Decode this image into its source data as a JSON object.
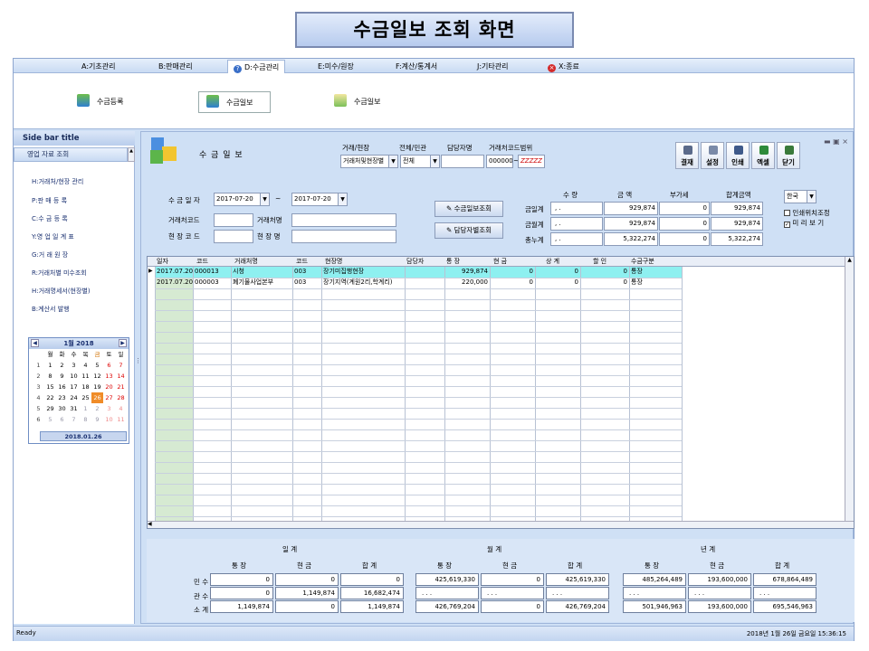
{
  "page_title": "수금일보 조회 화면",
  "menu": [
    {
      "label": "A:기초관리"
    },
    {
      "label": "B:판매관리"
    },
    {
      "label": "D:수금관리"
    },
    {
      "label": "E:미수/원장"
    },
    {
      "label": "F:계산/통계서"
    },
    {
      "label": "J:기타관리"
    },
    {
      "label": "X:종료"
    }
  ],
  "ribbon": {
    "b1": "수금등록",
    "b2": "수금일보",
    "b3": "수금일보"
  },
  "sidebar": {
    "title": "Side bar title",
    "section": "영업 자료 조회",
    "items": [
      "H:거래처/현장 관리",
      "P:판 매 등 록",
      "C:수 금 등 록",
      "Y:영 업 일 계 표",
      "G:거 래 원 장",
      "R:거래처별 미수조회",
      "H:거래명세서(현장별)",
      "B:계산서 발행"
    ]
  },
  "calendar": {
    "month": "1월 2018",
    "weekdays": [
      "월",
      "화",
      "수",
      "목",
      "금",
      "토",
      "일"
    ],
    "weeks": [
      {
        "n": "1",
        "d": [
          "1",
          "2",
          "3",
          "4",
          "5",
          "6",
          "7"
        ]
      },
      {
        "n": "2",
        "d": [
          "8",
          "9",
          "10",
          "11",
          "12",
          "13",
          "14"
        ]
      },
      {
        "n": "3",
        "d": [
          "15",
          "16",
          "17",
          "18",
          "19",
          "20",
          "21"
        ]
      },
      {
        "n": "4",
        "d": [
          "22",
          "23",
          "24",
          "25",
          "26",
          "27",
          "28"
        ]
      },
      {
        "n": "5",
        "d": [
          "29",
          "30",
          "31",
          "1",
          "2",
          "3",
          "4"
        ]
      },
      {
        "n": "6",
        "d": [
          "5",
          "6",
          "7",
          "8",
          "9",
          "10",
          "11"
        ]
      }
    ],
    "today": "2018.01.26"
  },
  "form": {
    "title": "수 금 일 보",
    "l_trade": "거래/현장",
    "trade_value": "거래처및현장별",
    "l_all": "전체/민관",
    "all_value": "전체",
    "l_manager": "담당자명",
    "l_range": "거래처코드범위",
    "range_from": "000000",
    "range_to": "ZZZZZ",
    "l_date": "수 금 일 자",
    "date_from": "2017-07-20",
    "tilde": "~",
    "date_to": "2017-07-20",
    "l_code": "거래처코드",
    "l_name": "거래처명",
    "l_sitecode": "현 장 코 드",
    "l_sitename": "현 장 명",
    "btn_query": "수금일보조회",
    "btn_manager": "담당자별조회"
  },
  "toolbar": {
    "b1": "결재",
    "b2": "설정",
    "b3": "인쇄",
    "b4": "엑셀",
    "b5": "닫기"
  },
  "summary": {
    "headers": [
      "수 량",
      "금 액",
      "부가세",
      "합계금액"
    ],
    "rows": [
      {
        "label": "금일계",
        "qty": ",  .",
        "amt": "929,874",
        "vat": "0",
        "total": "929,874"
      },
      {
        "label": "금월계",
        "qty": ",  .",
        "amt": "929,874",
        "vat": "0",
        "total": "929,874"
      },
      {
        "label": "총누계",
        "qty": ",  .",
        "amt": "5,322,274",
        "vat": "0",
        "total": "5,322,274"
      }
    ],
    "lang": "한국",
    "chk1": "인쇄위치조정",
    "chk2": "미 리 보 기"
  },
  "grid": {
    "columns": [
      "일자",
      "코드",
      "거래처명",
      "코드",
      "현장명",
      "담당자",
      "통 장",
      "현 금",
      "상 계",
      "할 인",
      "수금구분"
    ],
    "rows": [
      [
        "2017.07.20",
        "000013",
        "시청",
        "003",
        "장기미집행현장",
        "",
        "929,874",
        "0",
        "0",
        "0",
        "통장"
      ],
      [
        "2017.07.20",
        "000003",
        "폐기물사업본부",
        "003",
        "장기지역(계원2리,학계리)",
        "",
        "220,000",
        "0",
        "0",
        "0",
        "통장"
      ]
    ]
  },
  "bottom": {
    "g1": "일 계",
    "g2": "월 계",
    "g3": "년 계",
    "sub": [
      "통 장",
      "현 금",
      "합 계"
    ],
    "rowlabels": [
      "민 수",
      "관 수",
      "소 계"
    ],
    "day": [
      [
        "0",
        "0",
        "0"
      ],
      [
        "0",
        "1,149,874",
        "16,682,474"
      ],
      [
        "1,149,874",
        "0",
        "1,149,874"
      ]
    ],
    "month": [
      [
        "425,619,330",
        "0",
        "425,619,330"
      ],
      [
        ". . .",
        ". . .",
        ". . ."
      ],
      [
        "426,769,204",
        "0",
        "426,769,204"
      ]
    ],
    "year": [
      [
        "485,264,489",
        "193,600,000",
        "678,864,489"
      ],
      [
        ". . .",
        ". . .",
        ". . ."
      ],
      [
        "501,946,963",
        "193,600,000",
        "695,546,963"
      ]
    ]
  },
  "status": {
    "left": "Ready",
    "right": "2018년 1월 26일 금요일 15:36:15"
  }
}
